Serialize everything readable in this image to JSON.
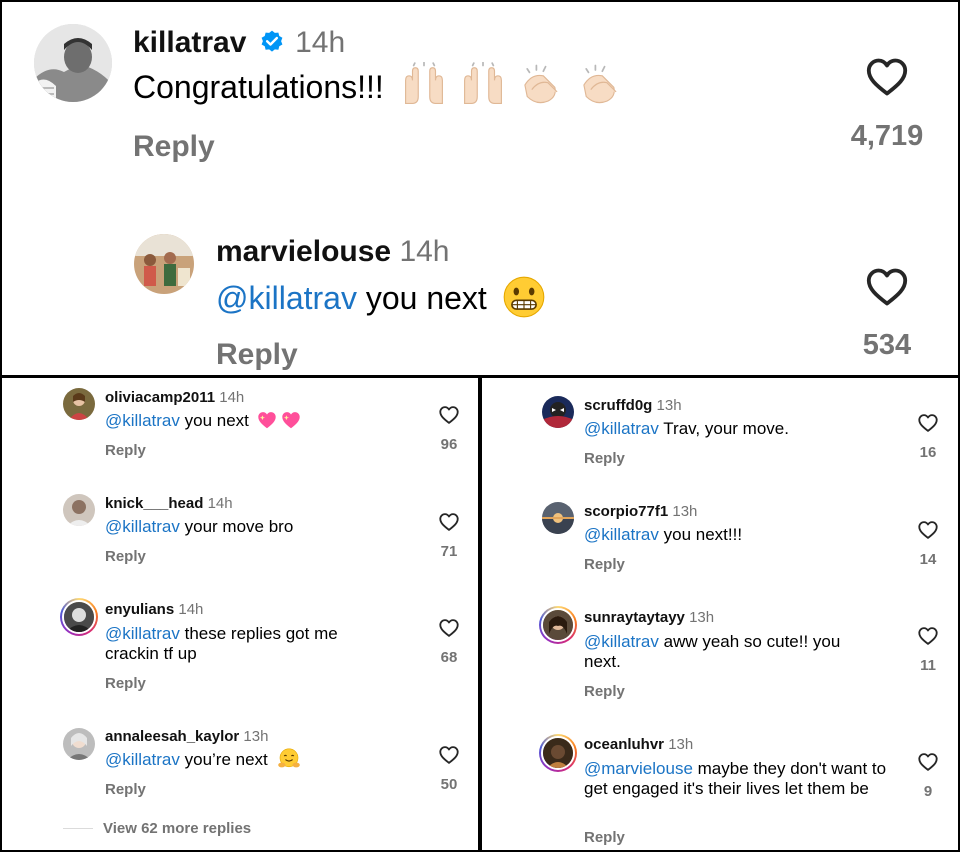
{
  "main_comment": {
    "username": "killatrav",
    "verified": true,
    "time": "14h",
    "text": "Congratulations!!!",
    "emojis": [
      "raising-hands",
      "raising-hands",
      "clapping-hands",
      "clapping-hands"
    ],
    "reply_label": "Reply",
    "likes": "4,719"
  },
  "top_reply": {
    "username": "marvielouse",
    "time": "14h",
    "mention": "@killatrav",
    "text": " you next",
    "emoji": "grimacing-face",
    "reply_label": "Reply",
    "likes": "534"
  },
  "left_replies": [
    {
      "username": "oliviacamp2011",
      "time": "14h",
      "mention": "@killatrav",
      "text": " you next",
      "emoji": "sparkling-hearts",
      "reply": "Reply",
      "likes": "96"
    },
    {
      "username": "knick___head",
      "time": "14h",
      "mention": "@killatrav",
      "text": " your move bro",
      "reply": "Reply",
      "likes": "71"
    },
    {
      "username": "enyulians",
      "time": "14h",
      "mention": "@killatrav",
      "text": " these replies got me crackin tf up",
      "reply": "Reply",
      "likes": "68"
    },
    {
      "username": "annaleesah_kaylor",
      "time": "13h",
      "mention": "@killatrav",
      "text": " you’re next",
      "emoji": "hugging-face",
      "reply": "Reply",
      "likes": "50"
    }
  ],
  "view_more": "View 62 more replies",
  "right_replies": [
    {
      "username": "scruffd0g",
      "time": "13h",
      "mention": "@killatrav",
      "text": " Trav, your move.",
      "reply": "Reply",
      "likes": "16"
    },
    {
      "username": "scorpio77f1",
      "time": "13h",
      "mention": "@killatrav",
      "text": " you next!!!",
      "reply": "Reply",
      "likes": "14"
    },
    {
      "username": "sunraytaytayy",
      "time": "13h",
      "mention": "@killatrav",
      "text": " aww yeah so cute!! you next.",
      "reply": "Reply",
      "likes": "11"
    },
    {
      "username": "oceanluhvr",
      "time": "13h",
      "mention": "@marvielouse",
      "text": " maybe they don't want to get engaged it's their lives let them be",
      "reply": "Reply",
      "likes": "9"
    }
  ],
  "colors": {
    "mention": "#1b74c5",
    "muted": "#737373",
    "verified": "#0095f6"
  }
}
